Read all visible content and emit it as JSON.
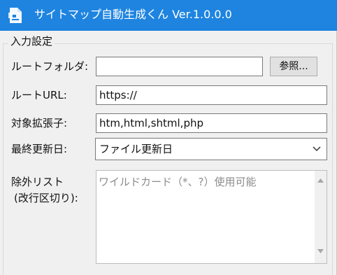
{
  "window": {
    "title": "サイトマップ自動生成くん Ver.1.0.0.0",
    "icon": "app-icon",
    "titlebar_color": "#1e84e0"
  },
  "settings_group": {
    "title": "入力設定"
  },
  "root_folder": {
    "label": "ルートフォルダ:",
    "value": "",
    "browse_button": "参照..."
  },
  "root_url": {
    "label": "ルートURL:",
    "value": "https://"
  },
  "extensions": {
    "label": "対象拡張子:",
    "value": "htm,html,shtml,php"
  },
  "last_modified": {
    "label": "最終更新日:",
    "selected": "ファイル更新日"
  },
  "exclude_list": {
    "label_line1": "除外リスト",
    "label_line2": "(改行区切り):",
    "placeholder": "ワイルドカード（*、?）使用可能"
  }
}
